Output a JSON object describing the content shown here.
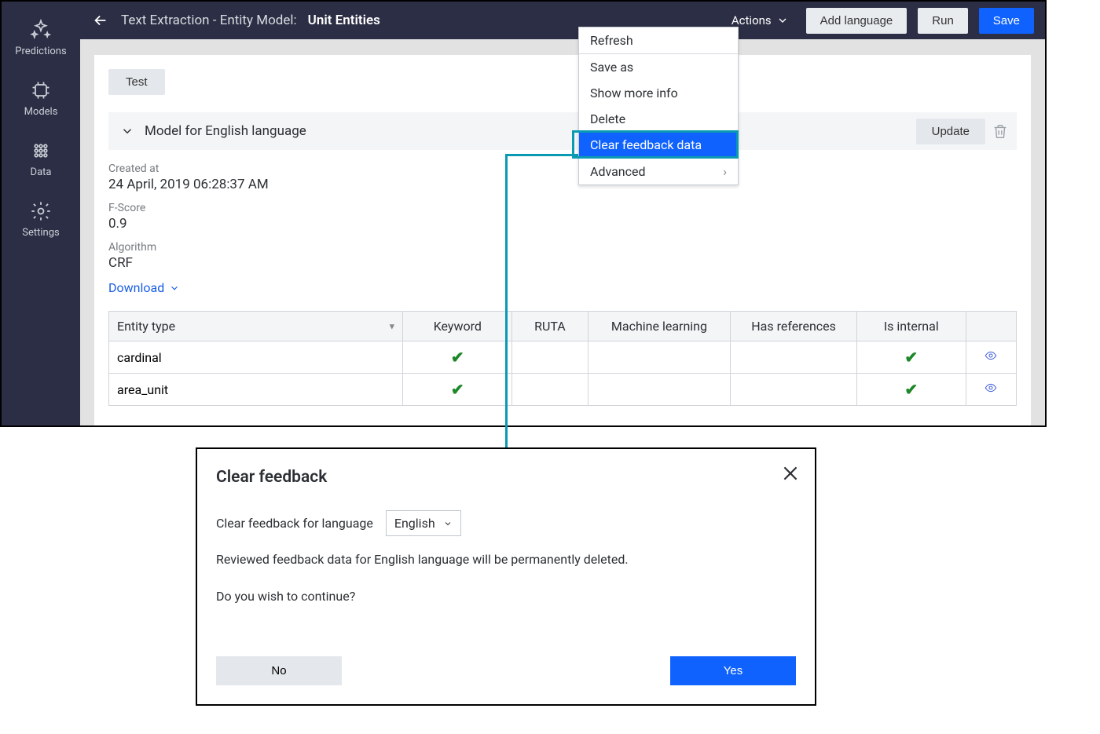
{
  "sidebar": {
    "items": [
      {
        "label": "Predictions"
      },
      {
        "label": "Models"
      },
      {
        "label": "Data"
      },
      {
        "label": "Settings"
      }
    ]
  },
  "header": {
    "prefix": "Text Extraction - Entity Model:",
    "title": "Unit Entities",
    "actions_label": "Actions",
    "add_language": "Add language",
    "run": "Run",
    "save": "Save"
  },
  "toolbar": {
    "test": "Test",
    "update": "Update"
  },
  "model": {
    "section_title": "Model for English language",
    "created_at_label": "Created at",
    "created_at_value": "24 April, 2019 06:28:37 AM",
    "fscore_label": "F-Score",
    "fscore_value": "0.9",
    "algorithm_label": "Algorithm",
    "algorithm_value": "CRF",
    "download": "Download"
  },
  "table": {
    "headers": {
      "entity_type": "Entity type",
      "keyword": "Keyword",
      "ruta": "RUTA",
      "ml": "Machine learning",
      "has_refs": "Has references",
      "is_internal": "Is internal"
    },
    "rows": [
      {
        "entity_type": "cardinal",
        "keyword": true,
        "is_internal": true
      },
      {
        "entity_type": "area_unit",
        "keyword": true,
        "is_internal": true
      }
    ]
  },
  "actions_menu": {
    "refresh": "Refresh",
    "save_as": "Save as",
    "show_more": "Show more info",
    "delete": "Delete",
    "clear_feedback": "Clear feedback data",
    "advanced": "Advanced"
  },
  "dialog": {
    "title": "Clear feedback",
    "label": "Clear feedback for language",
    "language": "English",
    "warning": "Reviewed feedback data for English language will be permanently deleted.",
    "confirm": "Do you wish to continue?",
    "no": "No",
    "yes": "Yes"
  }
}
